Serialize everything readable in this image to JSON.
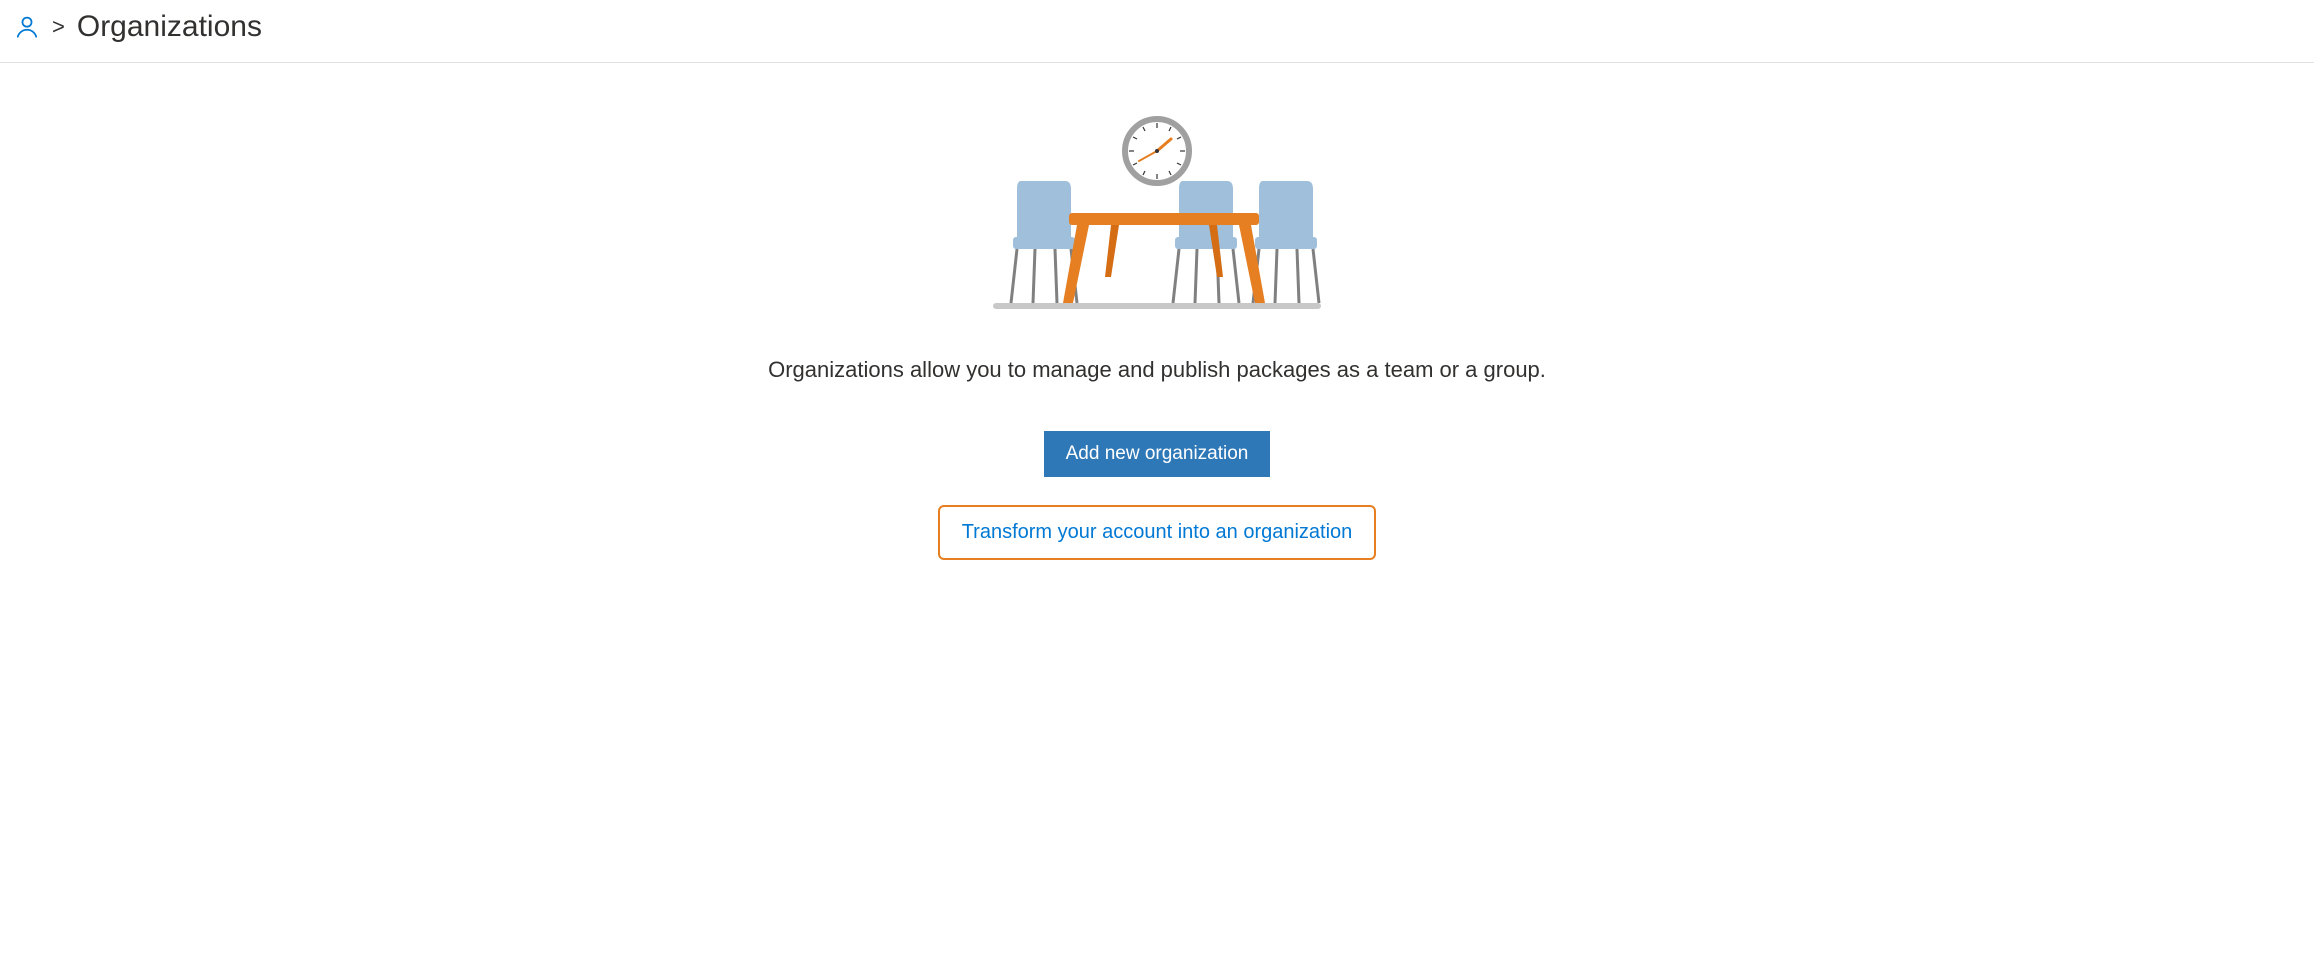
{
  "header": {
    "breadcrumb_separator": ">",
    "page_title": "Organizations"
  },
  "main": {
    "description": "Organizations allow you to manage and publish packages as a team or a group.",
    "add_button_label": "Add new organization",
    "transform_button_label": "Transform your account into an organization"
  },
  "colors": {
    "primary_button_bg": "#2e78b7",
    "outline_border": "#e67e22",
    "link_text": "#0078d4",
    "user_icon": "#0078d4"
  }
}
